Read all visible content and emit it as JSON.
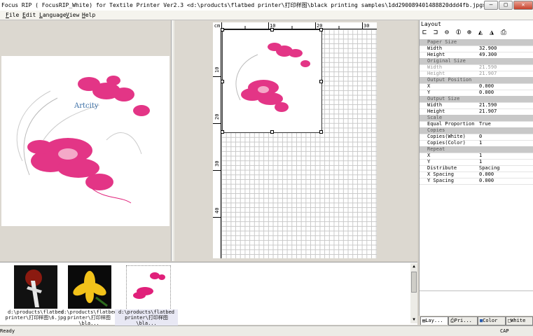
{
  "window": {
    "title": "Focus RIP ( FocusRIP_White) for Textile Printer Ver2.3 <d:\\products\\flatbed printer\\打印样图\\black printing samples\\1dd290089401488820ddd4fb.jpg>",
    "minimize": "–",
    "maximize": "□",
    "close": "✕"
  },
  "menu": [
    "File",
    "Edit",
    "Language",
    "View",
    "Help"
  ],
  "preview": {
    "logo_text": "Artcity"
  },
  "ruler": {
    "unit": "cm",
    "h_labels": [
      "10",
      "20",
      "30"
    ],
    "v_labels": [
      "10",
      "20",
      "30",
      "40"
    ]
  },
  "thumbnails": [
    {
      "label": "d:\\products\\flatbed printer\\打印样图\\6.jpg",
      "selected": false
    },
    {
      "label": "d:\\products\\flatbed printer\\打印样图\\bla...",
      "selected": false
    },
    {
      "label": "d:\\products\\flatbed printer\\打印样图\\bla...",
      "selected": true
    }
  ],
  "layout_panel": {
    "header": "Layout",
    "sections": [
      {
        "title": "Paper Size",
        "rows": [
          {
            "key": "Width",
            "value": "32.900"
          },
          {
            "key": "Height",
            "value": "49.300"
          }
        ]
      },
      {
        "title": "Original Size",
        "disabled": true,
        "rows": [
          {
            "key": "Width",
            "value": "21.590"
          },
          {
            "key": "Height",
            "value": "21.907"
          }
        ]
      },
      {
        "title": "Output Position",
        "rows": [
          {
            "key": "X",
            "value": "0.000"
          },
          {
            "key": "Y",
            "value": "0.000"
          }
        ]
      },
      {
        "title": "Output Size",
        "rows": [
          {
            "key": "Width",
            "value": "21.590"
          },
          {
            "key": "Height",
            "value": "21.907"
          }
        ]
      },
      {
        "title": "Scale",
        "rows": [
          {
            "key": "Equal Proportion",
            "value": "True"
          }
        ]
      },
      {
        "title": "Copies",
        "rows": [
          {
            "key": "Copies(White)",
            "value": "0"
          },
          {
            "key": "Copies(Color)",
            "value": "1"
          }
        ]
      },
      {
        "title": "Repeat",
        "rows": [
          {
            "key": "X",
            "value": "1"
          },
          {
            "key": "Y",
            "value": "1"
          },
          {
            "key": "Distribute",
            "value": "Spacing"
          },
          {
            "key": "X Spacing",
            "value": "0.000"
          },
          {
            "key": "Y Spacing",
            "value": "0.000"
          }
        ]
      }
    ]
  },
  "tabs": [
    {
      "label": "Lay...",
      "active": true
    },
    {
      "label": "Pri...",
      "active": false
    },
    {
      "label": "Color",
      "active": false
    },
    {
      "label": "White",
      "active": false
    }
  ],
  "status": {
    "left": "Ready",
    "right": "CAP"
  },
  "colors": {
    "accent_magenta": "#e0207a",
    "panel_bg": "#dcd8d0",
    "section_bg": "#c8c8c8"
  }
}
